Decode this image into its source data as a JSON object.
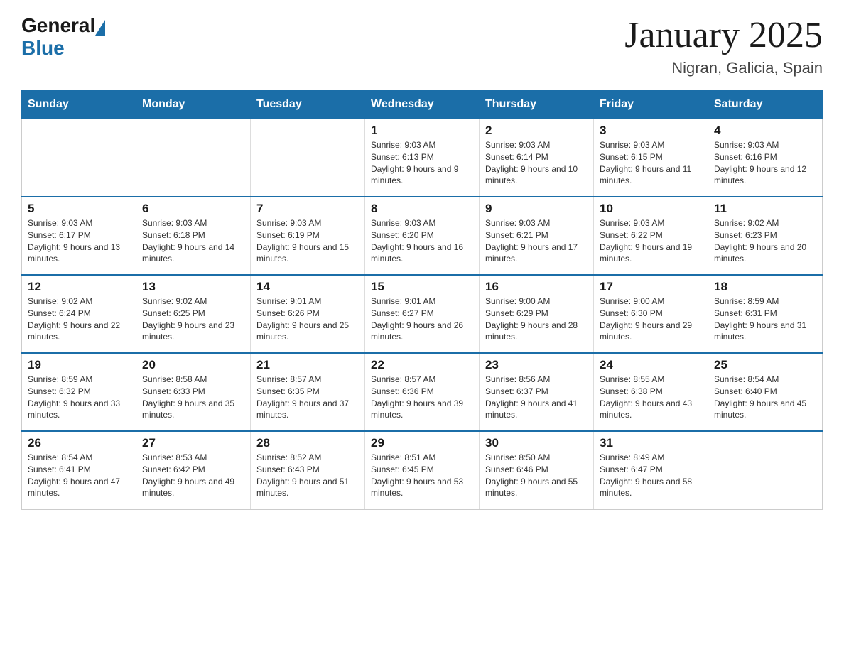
{
  "header": {
    "logo_general": "General",
    "logo_blue": "Blue",
    "title": "January 2025",
    "subtitle": "Nigran, Galicia, Spain"
  },
  "days_of_week": [
    "Sunday",
    "Monday",
    "Tuesday",
    "Wednesday",
    "Thursday",
    "Friday",
    "Saturday"
  ],
  "weeks": [
    [
      {
        "day": "",
        "info": ""
      },
      {
        "day": "",
        "info": ""
      },
      {
        "day": "",
        "info": ""
      },
      {
        "day": "1",
        "info": "Sunrise: 9:03 AM\nSunset: 6:13 PM\nDaylight: 9 hours and 9 minutes."
      },
      {
        "day": "2",
        "info": "Sunrise: 9:03 AM\nSunset: 6:14 PM\nDaylight: 9 hours and 10 minutes."
      },
      {
        "day": "3",
        "info": "Sunrise: 9:03 AM\nSunset: 6:15 PM\nDaylight: 9 hours and 11 minutes."
      },
      {
        "day": "4",
        "info": "Sunrise: 9:03 AM\nSunset: 6:16 PM\nDaylight: 9 hours and 12 minutes."
      }
    ],
    [
      {
        "day": "5",
        "info": "Sunrise: 9:03 AM\nSunset: 6:17 PM\nDaylight: 9 hours and 13 minutes."
      },
      {
        "day": "6",
        "info": "Sunrise: 9:03 AM\nSunset: 6:18 PM\nDaylight: 9 hours and 14 minutes."
      },
      {
        "day": "7",
        "info": "Sunrise: 9:03 AM\nSunset: 6:19 PM\nDaylight: 9 hours and 15 minutes."
      },
      {
        "day": "8",
        "info": "Sunrise: 9:03 AM\nSunset: 6:20 PM\nDaylight: 9 hours and 16 minutes."
      },
      {
        "day": "9",
        "info": "Sunrise: 9:03 AM\nSunset: 6:21 PM\nDaylight: 9 hours and 17 minutes."
      },
      {
        "day": "10",
        "info": "Sunrise: 9:03 AM\nSunset: 6:22 PM\nDaylight: 9 hours and 19 minutes."
      },
      {
        "day": "11",
        "info": "Sunrise: 9:02 AM\nSunset: 6:23 PM\nDaylight: 9 hours and 20 minutes."
      }
    ],
    [
      {
        "day": "12",
        "info": "Sunrise: 9:02 AM\nSunset: 6:24 PM\nDaylight: 9 hours and 22 minutes."
      },
      {
        "day": "13",
        "info": "Sunrise: 9:02 AM\nSunset: 6:25 PM\nDaylight: 9 hours and 23 minutes."
      },
      {
        "day": "14",
        "info": "Sunrise: 9:01 AM\nSunset: 6:26 PM\nDaylight: 9 hours and 25 minutes."
      },
      {
        "day": "15",
        "info": "Sunrise: 9:01 AM\nSunset: 6:27 PM\nDaylight: 9 hours and 26 minutes."
      },
      {
        "day": "16",
        "info": "Sunrise: 9:00 AM\nSunset: 6:29 PM\nDaylight: 9 hours and 28 minutes."
      },
      {
        "day": "17",
        "info": "Sunrise: 9:00 AM\nSunset: 6:30 PM\nDaylight: 9 hours and 29 minutes."
      },
      {
        "day": "18",
        "info": "Sunrise: 8:59 AM\nSunset: 6:31 PM\nDaylight: 9 hours and 31 minutes."
      }
    ],
    [
      {
        "day": "19",
        "info": "Sunrise: 8:59 AM\nSunset: 6:32 PM\nDaylight: 9 hours and 33 minutes."
      },
      {
        "day": "20",
        "info": "Sunrise: 8:58 AM\nSunset: 6:33 PM\nDaylight: 9 hours and 35 minutes."
      },
      {
        "day": "21",
        "info": "Sunrise: 8:57 AM\nSunset: 6:35 PM\nDaylight: 9 hours and 37 minutes."
      },
      {
        "day": "22",
        "info": "Sunrise: 8:57 AM\nSunset: 6:36 PM\nDaylight: 9 hours and 39 minutes."
      },
      {
        "day": "23",
        "info": "Sunrise: 8:56 AM\nSunset: 6:37 PM\nDaylight: 9 hours and 41 minutes."
      },
      {
        "day": "24",
        "info": "Sunrise: 8:55 AM\nSunset: 6:38 PM\nDaylight: 9 hours and 43 minutes."
      },
      {
        "day": "25",
        "info": "Sunrise: 8:54 AM\nSunset: 6:40 PM\nDaylight: 9 hours and 45 minutes."
      }
    ],
    [
      {
        "day": "26",
        "info": "Sunrise: 8:54 AM\nSunset: 6:41 PM\nDaylight: 9 hours and 47 minutes."
      },
      {
        "day": "27",
        "info": "Sunrise: 8:53 AM\nSunset: 6:42 PM\nDaylight: 9 hours and 49 minutes."
      },
      {
        "day": "28",
        "info": "Sunrise: 8:52 AM\nSunset: 6:43 PM\nDaylight: 9 hours and 51 minutes."
      },
      {
        "day": "29",
        "info": "Sunrise: 8:51 AM\nSunset: 6:45 PM\nDaylight: 9 hours and 53 minutes."
      },
      {
        "day": "30",
        "info": "Sunrise: 8:50 AM\nSunset: 6:46 PM\nDaylight: 9 hours and 55 minutes."
      },
      {
        "day": "31",
        "info": "Sunrise: 8:49 AM\nSunset: 6:47 PM\nDaylight: 9 hours and 58 minutes."
      },
      {
        "day": "",
        "info": ""
      }
    ]
  ]
}
